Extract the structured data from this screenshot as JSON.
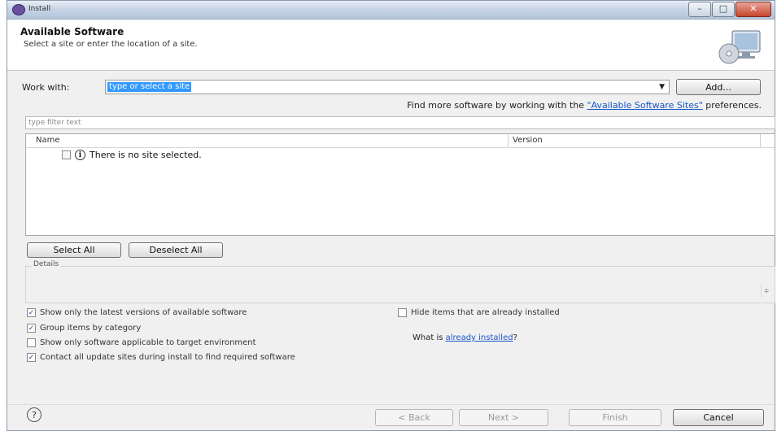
{
  "window": {
    "title": "Install"
  },
  "header": {
    "title": "Available Software",
    "description": "Select a site or enter the location of a site."
  },
  "work_with": {
    "label": "Work with:",
    "value": "type or select a site",
    "add_label": "Add..."
  },
  "hint": {
    "prefix": "Find more software by working with the ",
    "link": "\"Available Software Sites\"",
    "suffix": " preferences."
  },
  "filter": {
    "placeholder": "type filter text"
  },
  "tree": {
    "columns": [
      "Name",
      "Version"
    ],
    "message": "There is no site selected."
  },
  "buttons": {
    "select_all": "Select All",
    "deselect_all": "Deselect All",
    "back": "< Back",
    "next": "Next >",
    "finish": "Finish",
    "cancel": "Cancel"
  },
  "details": {
    "label": "Details"
  },
  "options": {
    "latest_versions": {
      "label": "Show only the latest versions of available software",
      "checked": true
    },
    "hide_installed": {
      "label": "Hide items that are already installed",
      "checked": false
    },
    "group_by_category": {
      "label": "Group items by category",
      "checked": true
    },
    "target_env": {
      "label": "Show only software applicable to target environment",
      "checked": false
    },
    "contact_sites": {
      "label": "Contact all update sites during install to find required software",
      "checked": true
    }
  },
  "what_is": {
    "prefix": "What is ",
    "link": "already installed",
    "suffix": "?"
  },
  "colors": {
    "selection": "#3399ff",
    "link": "#1a56c9",
    "dialog_bg": "#f0f0f0"
  },
  "icons": [
    "install-window-icon",
    "monitor-cd-icon",
    "info-icon",
    "help-icon",
    "dropdown-arrow-icon"
  ]
}
